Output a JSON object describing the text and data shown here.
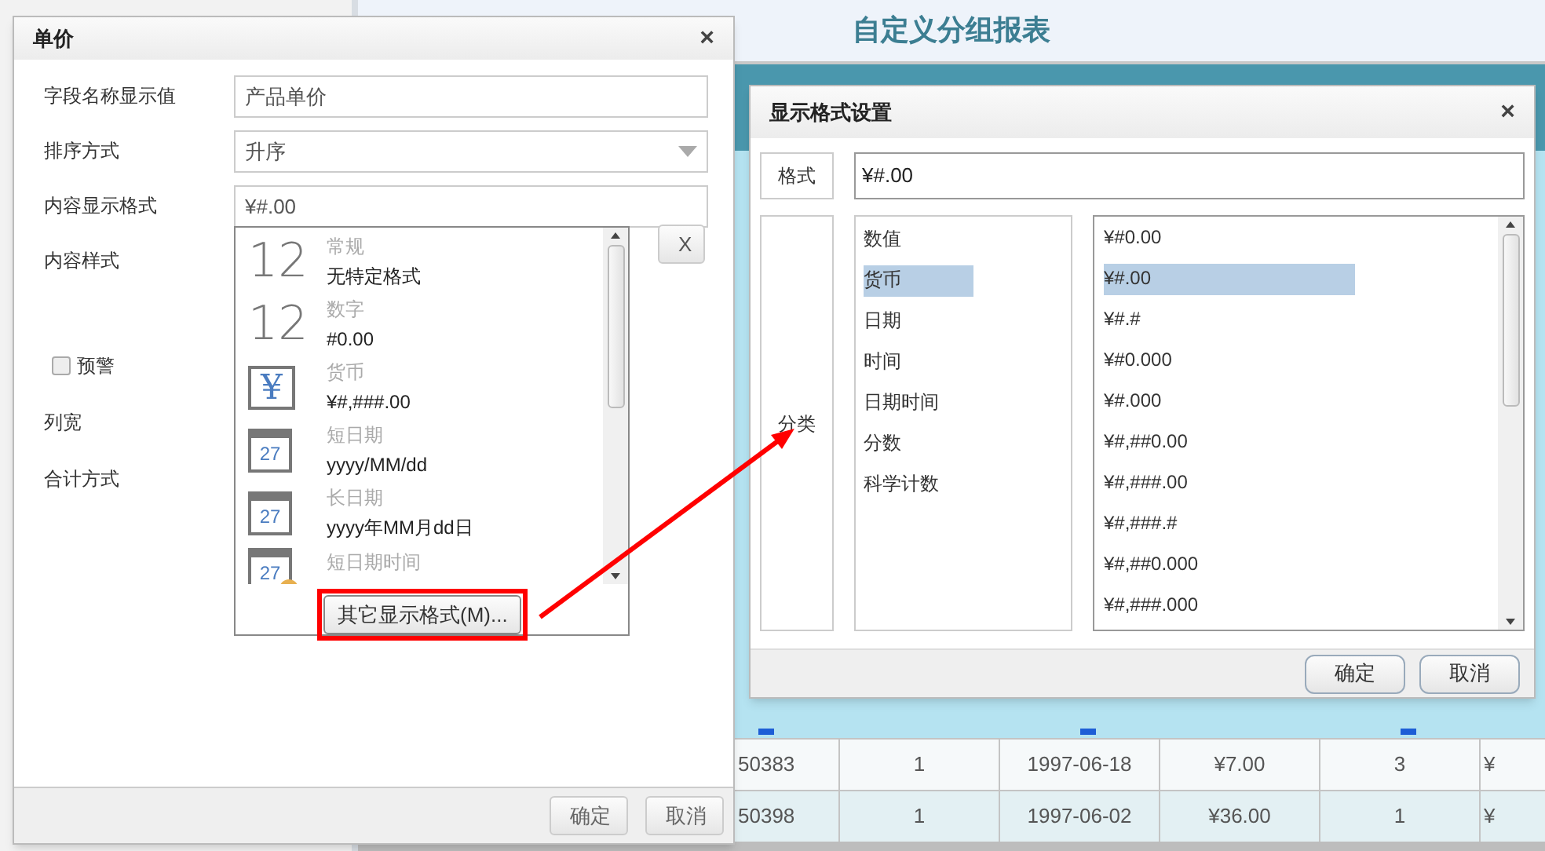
{
  "report": {
    "title": "自定义分组报表",
    "rows": [
      [
        "50383",
        "1",
        "1997-06-18",
        "¥7.00",
        "3",
        "¥"
      ],
      [
        "50398",
        "1",
        "1997-06-02",
        "¥36.00",
        "1",
        "¥"
      ]
    ]
  },
  "field_dialog": {
    "title": "单价",
    "close": "×",
    "fields": [
      {
        "label": "字段名称显示值",
        "kind": "text",
        "value": "产品单价"
      },
      {
        "label": "排序方式",
        "kind": "select",
        "value": "升序"
      },
      {
        "label": "内容显示格式",
        "kind": "text",
        "value": "¥#.00"
      },
      {
        "label": "内容样式",
        "kind": "none"
      }
    ],
    "clear_button": "X",
    "warning": {
      "label": "预警",
      "checked": false
    },
    "extra_labels": [
      "列宽",
      "合计方式"
    ],
    "format_dropdown": {
      "items": [
        {
          "kind": "number",
          "icon_text": "12",
          "category": "常规",
          "format": "无特定格式"
        },
        {
          "kind": "number",
          "icon_text": "12",
          "category": "数字",
          "format": "#0.00"
        },
        {
          "kind": "currency",
          "icon_text": "¥",
          "category": "货币",
          "format": "¥#,###.00"
        },
        {
          "kind": "date",
          "icon_text": "27",
          "category": "短日期",
          "format": "yyyy/MM/dd"
        },
        {
          "kind": "date",
          "icon_text": "27",
          "category": "长日期",
          "format": "yyyy年MM月dd日"
        },
        {
          "kind": "datetime",
          "icon_text": "27",
          "category": "短日期时间"
        }
      ],
      "more_button": "其它显示格式(M)..."
    },
    "buttons": [
      "确定",
      "取消"
    ]
  },
  "format_dialog": {
    "title": "显示格式设置",
    "close": "×",
    "format_label": "格式",
    "format_value": "¥#.00",
    "category_label": "分类",
    "categories": [
      {
        "label": "数值",
        "selected": false
      },
      {
        "label": "货币",
        "selected": true
      },
      {
        "label": "日期",
        "selected": false
      },
      {
        "label": "时间",
        "selected": false
      },
      {
        "label": "日期时间",
        "selected": false
      },
      {
        "label": "分数",
        "selected": false
      },
      {
        "label": "科学计数",
        "selected": false
      }
    ],
    "formats": [
      {
        "label": "¥#0.00",
        "selected": false
      },
      {
        "label": "¥#.00",
        "selected": true
      },
      {
        "label": "¥#.#",
        "selected": false
      },
      {
        "label": "¥#0.000",
        "selected": false
      },
      {
        "label": "¥#.000",
        "selected": false
      },
      {
        "label": "¥#,##0.00",
        "selected": false
      },
      {
        "label": "¥#,###.00",
        "selected": false
      },
      {
        "label": "¥#,###.#",
        "selected": false
      },
      {
        "label": "¥#,##0.000",
        "selected": false
      },
      {
        "label": "¥#,###.000",
        "selected": false
      }
    ],
    "buttons": [
      "确定",
      "取消"
    ]
  }
}
